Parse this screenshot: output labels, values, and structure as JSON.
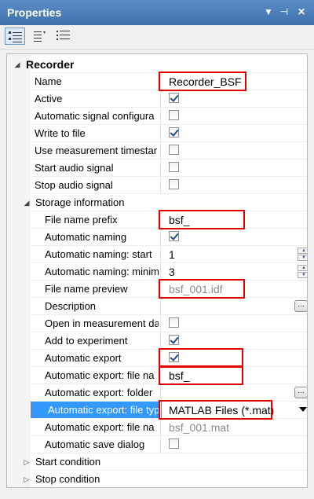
{
  "window": {
    "title": "Properties"
  },
  "titlebar_buttons": [
    "dropdown-arrow-icon",
    "pin-icon",
    "close-icon"
  ],
  "toolbar": {
    "tools": [
      "categorized-view-icon",
      "alphabetical-view-icon",
      "property-pages-icon"
    ]
  },
  "rows": [
    {
      "type": "category",
      "label": "Recorder",
      "expanded": true
    },
    {
      "type": "prop",
      "label": "Name",
      "value": "Recorder_BSF"
    },
    {
      "type": "prop",
      "label": "Active",
      "checked": true
    },
    {
      "type": "prop",
      "label": "Automatic signal configura",
      "checked": false
    },
    {
      "type": "prop",
      "label": "Write to file",
      "checked": true
    },
    {
      "type": "prop",
      "label": "Use measurement timestar",
      "checked": false
    },
    {
      "type": "prop",
      "label": "Start audio signal",
      "checked": false
    },
    {
      "type": "prop",
      "label": "Stop audio signal",
      "checked": false
    },
    {
      "type": "subcategory",
      "label": "Storage information",
      "expanded": true
    },
    {
      "type": "prop",
      "label": "File name prefix",
      "value": "bsf_"
    },
    {
      "type": "prop",
      "label": "Automatic naming",
      "checked": true
    },
    {
      "type": "prop",
      "label": "Automatic naming: start",
      "value": "1",
      "spinner": true
    },
    {
      "type": "prop",
      "label": "Automatic naming: minim",
      "value": "3",
      "spinner": true
    },
    {
      "type": "prop",
      "label": "File name preview",
      "value": "bsf_001.idf",
      "readonly": true
    },
    {
      "type": "prop",
      "label": "Description",
      "value": "",
      "ellipsis": true
    },
    {
      "type": "prop",
      "label": "Open in measurement da",
      "checked": false
    },
    {
      "type": "prop",
      "label": "Add to experiment",
      "checked": true
    },
    {
      "type": "prop",
      "label": "Automatic export",
      "checked": true
    },
    {
      "type": "prop",
      "label": "Automatic export: file na",
      "value": "bsf_"
    },
    {
      "type": "prop",
      "label": "Automatic export: folder",
      "value": "",
      "ellipsis": true
    },
    {
      "type": "prop",
      "label": "Automatic export: file typ",
      "value": "MATLAB Files (*.mat)",
      "dropdown": true,
      "selected": true
    },
    {
      "type": "prop",
      "label": "Automatic export: file na",
      "value": "bsf_001.mat",
      "readonly": true
    },
    {
      "type": "prop",
      "label": "Automatic save dialog",
      "checked": false
    },
    {
      "type": "subcategory",
      "label": "Start condition",
      "expanded": false
    },
    {
      "type": "subcategory",
      "label": "Stop condition",
      "expanded": false
    }
  ],
  "colors": {
    "titlebar": "#3f72ad",
    "selection": "#3399ff",
    "highlight_box": "#e00000",
    "readonly_text": "#8a8a8a"
  }
}
